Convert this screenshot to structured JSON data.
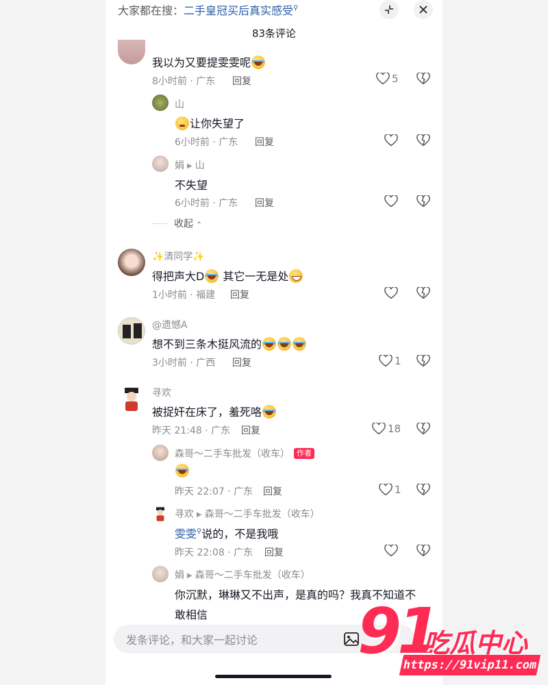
{
  "header": {
    "search_prefix": "大家都在搜：",
    "search_term": "二手皇冠买后真实感受",
    "comment_count": "83条评论"
  },
  "comments": [
    {
      "text": "我以为又要提雯雯呢",
      "time": "8小时前 · 广东",
      "reply": "回复",
      "likes": "5"
    },
    {
      "name": "山",
      "text": "让你失望了",
      "time": "6小时前 · 广东",
      "reply": "回复"
    },
    {
      "name": "娟",
      "to": "山",
      "text": "不失望",
      "time": "6小时前 · 广东",
      "reply": "回复"
    },
    {
      "name": "✨清同学✨",
      "text": "得把声大D",
      "text2": " 其它一无是处",
      "time": "1小时前 · 福建",
      "reply": "回复"
    },
    {
      "name": "@遗憾A",
      "text": "想不到三条木挺风流的",
      "time": "3小时前 · 广西",
      "reply": "回复",
      "likes": "1"
    },
    {
      "name": "寻欢",
      "text": "被捉奸在床了，羞死咯",
      "time": "昨天 21:48 · 广东",
      "reply": "回复",
      "likes": "18"
    },
    {
      "name": "森哥～二手车批发（收车）",
      "tag": "作者",
      "time": "昨天 22:07 · 广东",
      "reply": "回复",
      "likes": "1"
    },
    {
      "name": "寻欢",
      "to": "森哥～二手车批发（收车）",
      "mention": "雯雯",
      "text": "说的，不是我哦",
      "time": "昨天 22:08 · 广东",
      "reply": "回复"
    },
    {
      "name": "娟",
      "to": "森哥～二手车批发（收车）",
      "text": "你沉默，琳琳又不出声，是真的吗？我真不知道不",
      "text2": "敢相信"
    }
  ],
  "collapse_label": "收起",
  "input": {
    "placeholder": "发条评论，和大家一起讨论"
  },
  "watermark": {
    "number": "91",
    "brand": "吃瓜中心",
    "url": "https://91vip11.com"
  },
  "colors": {
    "accent": "#fe2c55",
    "link": "#2b5ea7"
  }
}
